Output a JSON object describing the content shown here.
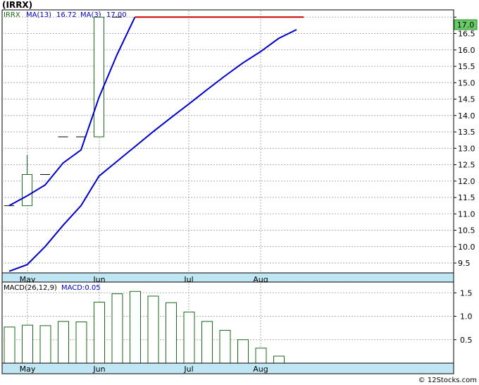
{
  "ticker_title": "(IRRX)",
  "price_panel": {
    "symbol": "IRRX",
    "ma13_label": "MA(13)",
    "ma13_value": "16.72",
    "ma3_label": "MA(3)",
    "ma3_value": "17.00",
    "last_price_badge": "17.0",
    "colors": {
      "ma13": "#0000cc",
      "ma3": "#0000cc",
      "last_line": "#cc0000",
      "up_candle": "#1a6b1a",
      "axis_band": "#bfe6f2"
    }
  },
  "macd_panel": {
    "label": "MACD(26,12,9)",
    "value_label": "MACD:0.05",
    "bar_color": "#1a6b1a"
  },
  "watermark": "© 12Stocks.com",
  "chart_data": [
    {
      "type": "candlestick",
      "title": "(IRRX)",
      "x_month_labels": [
        "May",
        "Jun",
        "Jul",
        "Aug"
      ],
      "y_ticks": [
        9.5,
        10.0,
        10.5,
        11.0,
        11.5,
        12.0,
        12.5,
        13.0,
        13.5,
        14.0,
        14.5,
        15.0,
        15.5,
        16.0,
        16.5,
        17.0
      ],
      "ylim": [
        9.2,
        17.2
      ],
      "weeks": 17,
      "candles": [
        {
          "week": 0,
          "open": 11.25,
          "close": 11.25,
          "high": 11.25,
          "low": 11.25
        },
        {
          "week": 1,
          "open": 11.25,
          "close": 12.2,
          "high": 12.8,
          "low": 11.25
        },
        {
          "week": 2,
          "open": 12.2,
          "close": 12.2,
          "high": 12.2,
          "low": 12.2
        },
        {
          "week": 3,
          "open": 13.35,
          "close": 13.35,
          "high": 13.35,
          "low": 13.35
        },
        {
          "week": 4,
          "open": 13.35,
          "close": 13.35,
          "high": 13.35,
          "low": 13.35
        },
        {
          "week": 5,
          "open": 13.35,
          "close": 17.0,
          "high": 17.0,
          "low": 13.35
        },
        {
          "week": 6,
          "open": 17.0,
          "close": 17.0,
          "high": 17.0,
          "low": 17.0
        }
      ],
      "ma3": [
        {
          "week": 0,
          "value": 11.25
        },
        {
          "week": 1,
          "value": 11.55
        },
        {
          "week": 2,
          "value": 11.88
        },
        {
          "week": 3,
          "value": 12.55
        },
        {
          "week": 4,
          "value": 12.95
        },
        {
          "week": 5,
          "value": 14.55
        },
        {
          "week": 6,
          "value": 15.85
        },
        {
          "week": 7,
          "value": 17.0
        },
        {
          "week": 16,
          "value": 17.0
        }
      ],
      "ma13": [
        {
          "week": 0,
          "value": 9.25
        },
        {
          "week": 1,
          "value": 9.45
        },
        {
          "week": 2,
          "value": 10.0
        },
        {
          "week": 3,
          "value": 10.65
        },
        {
          "week": 4,
          "value": 11.25
        },
        {
          "week": 5,
          "value": 12.15
        },
        {
          "week": 6,
          "value": 12.6
        },
        {
          "week": 7,
          "value": 13.05
        },
        {
          "week": 8,
          "value": 13.5
        },
        {
          "week": 9,
          "value": 13.93
        },
        {
          "week": 10,
          "value": 14.35
        },
        {
          "week": 11,
          "value": 14.78
        },
        {
          "week": 12,
          "value": 15.2
        },
        {
          "week": 13,
          "value": 15.6
        },
        {
          "week": 14,
          "value": 15.95
        },
        {
          "week": 15,
          "value": 16.35
        },
        {
          "week": 16,
          "value": 16.62
        }
      ],
      "last_price": 17.0
    },
    {
      "type": "bar",
      "title": "MACD(26,12,9)",
      "x_month_labels": [
        "May",
        "Jun",
        "Jul",
        "Aug"
      ],
      "y_ticks": [
        0.5,
        1.0,
        1.5
      ],
      "ylim": [
        0,
        1.7
      ],
      "values": [
        0.77,
        0.81,
        0.8,
        0.89,
        0.88,
        1.3,
        1.48,
        1.53,
        1.43,
        1.29,
        1.09,
        0.89,
        0.7,
        0.5,
        0.32,
        0.15
      ]
    }
  ]
}
